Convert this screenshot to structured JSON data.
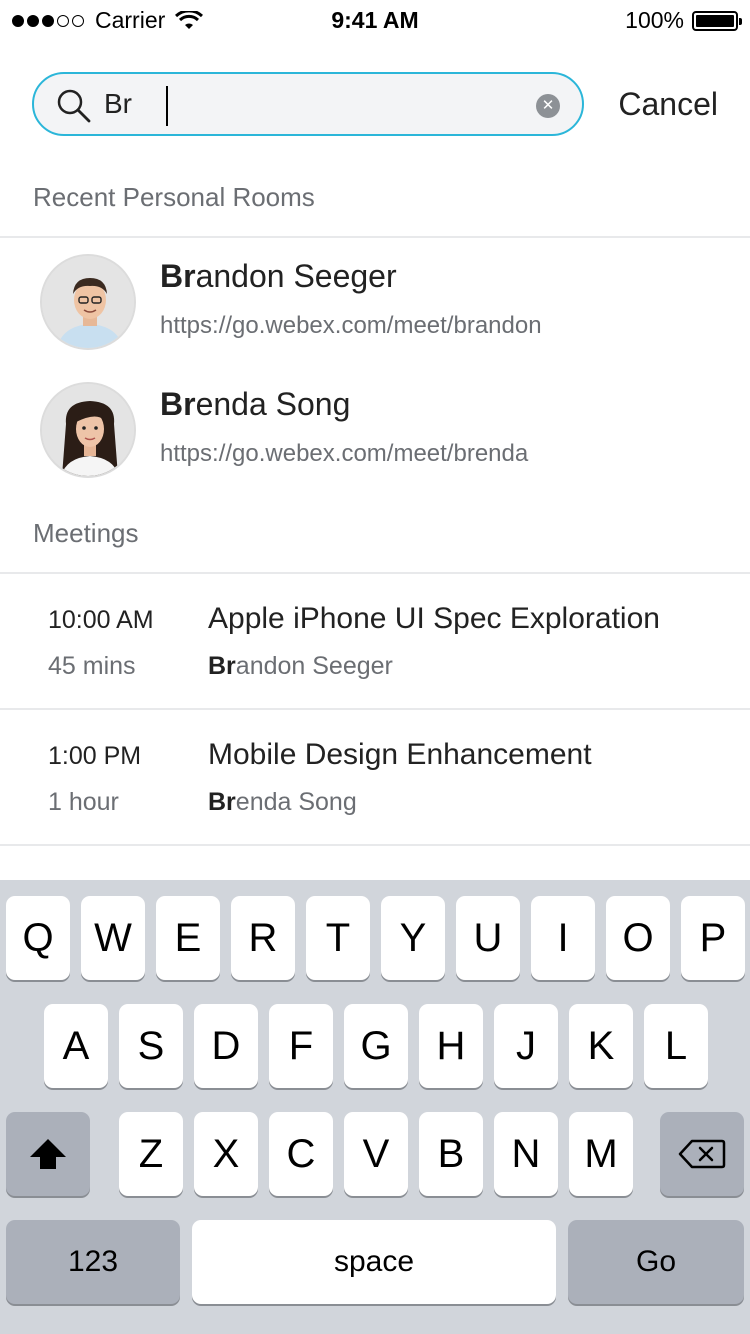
{
  "status_bar": {
    "carrier": "Carrier",
    "time": "9:41 AM",
    "battery": "100%",
    "signal_bars_filled": 3,
    "signal_bars_total": 5
  },
  "search": {
    "value": "Br",
    "placeholder": "",
    "cancel_label": "Cancel"
  },
  "recent_rooms": {
    "header": "Recent Personal Rooms",
    "items": [
      {
        "name_match": "Br",
        "name_rest": "andon Seeger",
        "url": "https://go.webex.com/meet/brandon"
      },
      {
        "name_match": "Br",
        "name_rest": "enda Song",
        "url": "https://go.webex.com/meet/brenda"
      }
    ]
  },
  "meetings": {
    "header": "Meetings",
    "items": [
      {
        "time": "10:00 AM",
        "duration": "45 mins",
        "title": "Apple iPhone UI Spec Exploration",
        "host_match": "Br",
        "host_rest": "andon Seeger"
      },
      {
        "time": "1:00 PM",
        "duration": "1 hour",
        "title": "Mobile Design Enhancement",
        "host_match": "Br",
        "host_rest": "enda Song"
      }
    ]
  },
  "keyboard": {
    "row1": [
      "Q",
      "W",
      "E",
      "R",
      "T",
      "Y",
      "U",
      "I",
      "O",
      "P"
    ],
    "row2": [
      "A",
      "S",
      "D",
      "F",
      "G",
      "H",
      "J",
      "K",
      "L"
    ],
    "row3": [
      "Z",
      "X",
      "C",
      "V",
      "B",
      "N",
      "M"
    ],
    "numbers_label": "123",
    "space_label": "space",
    "go_label": "Go"
  },
  "colors": {
    "accent": "#2bb6d9",
    "keyboard_bg": "#d1d5db",
    "dark_key": "#abb0ba"
  }
}
